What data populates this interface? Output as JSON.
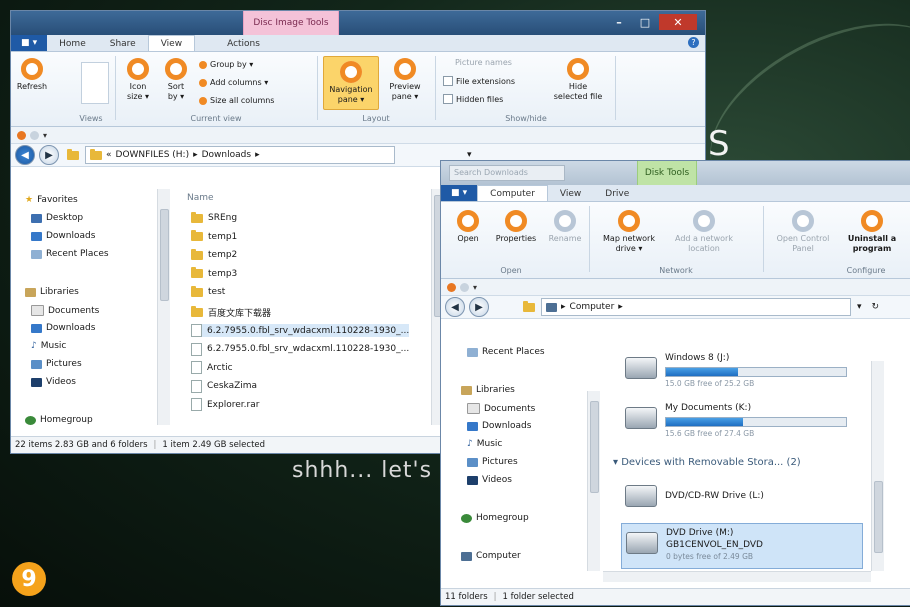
{
  "desktop": {
    "text_s": "S",
    "text_shh": "shhh... let's",
    "step_badge": "9"
  },
  "win1": {
    "context_tab": "Disc Image Tools",
    "window_buttons": {
      "minimize": "–",
      "maximize": "□",
      "close": "✕"
    },
    "file_tab": "■ ▾",
    "tabs": [
      "Home",
      "Share",
      "View",
      "Actions"
    ],
    "help": "?",
    "ribbon": {
      "refresh": "Refresh",
      "icon_size": "Icon\nsize ▾",
      "sort_by": "Sort\nby ▾",
      "group_by": "Group by ▾",
      "add_columns": "Add columns ▾",
      "size_all_columns": "Size all columns",
      "navigation_pane": "Navigation\npane ▾",
      "preview_pane": "Preview\npane ▾",
      "picture_names": "Picture names",
      "file_extensions": "File extensions",
      "hidden_files": "Hidden files",
      "hide_selected": "Hide\nselected file",
      "groups": {
        "views": "Views",
        "current_view": "Current view",
        "layout": "Layout",
        "show_hide": "Show/hide"
      }
    },
    "qat_arrow": "▾",
    "address": {
      "root": "«",
      "drive": "DOWNFILES (H:)",
      "sep": "▸",
      "folder": "Downloads",
      "end": "▸",
      "dropdown": "▾"
    },
    "nav": {
      "favorites": "Favorites",
      "desktop": "Desktop",
      "downloads": "Downloads",
      "recent": "Recent Places",
      "libraries": "Libraries",
      "documents": "Documents",
      "downloads2": "Downloads",
      "music": "Music",
      "pictures": "Pictures",
      "videos": "Videos",
      "homegroup": "Homegroup"
    },
    "column_name": "Name",
    "files": [
      "SREng",
      "temp1",
      "temp2",
      "temp3",
      "test",
      "百度文库下载器",
      "6.2.7955.0.fbl_srv_wdacxml.110228-1930_...",
      "6.2.7955.0.fbl_srv_wdacxml.110228-1930_...",
      "Arctic",
      "CeskaZima",
      "Explorer.rar"
    ],
    "status": {
      "items": "22 items 2.83 GB and 6 folders",
      "selected": "1 item 2.49 GB selected"
    }
  },
  "win2": {
    "search_placeholder": "Search Downloads",
    "context_tab": "Disk Tools",
    "file_tab": "■ ▾",
    "tabs": [
      "Computer",
      "View",
      "Drive"
    ],
    "ribbon": {
      "open": "Open",
      "properties": "Properties",
      "rename": "Rename",
      "map_network": "Map network\ndrive ▾",
      "add_network": "Add a network\nlocation",
      "open_control": "Open Control\nPanel",
      "uninstall": "Uninstall a\nprogram",
      "groups": {
        "open": "Open",
        "network": "Network",
        "configure": "Configure"
      }
    },
    "qat_arrow": "▾",
    "address": {
      "sep": "▸",
      "computer": "Computer",
      "end": "▸",
      "dropdown": "▾",
      "refresh": "↻"
    },
    "nav": {
      "recent": "Recent Places",
      "libraries": "Libraries",
      "documents": "Documents",
      "downloads": "Downloads",
      "music": "Music",
      "pictures": "Pictures",
      "videos": "Videos",
      "homegroup": "Homegroup",
      "computer": "Computer"
    },
    "drives": [
      {
        "name": "Windows 8 (J:)",
        "free": "15.0 GB free of 25.2 GB",
        "used": 0.4
      },
      {
        "name": "My Documents (K:)",
        "free": "15.6 GB free of 27.4 GB",
        "used": 0.43
      }
    ],
    "removable_header": "Devices with Removable Stora... (2)",
    "dvd_rw": "DVD/CD-RW Drive (L:)",
    "dvd": {
      "name": "DVD Drive (M:)",
      "label": "GB1CENVOL_EN_DVD",
      "free": "0 bytes free of 2.49 GB"
    },
    "status": {
      "folders": "11 folders",
      "selected": "1 folder selected"
    }
  }
}
